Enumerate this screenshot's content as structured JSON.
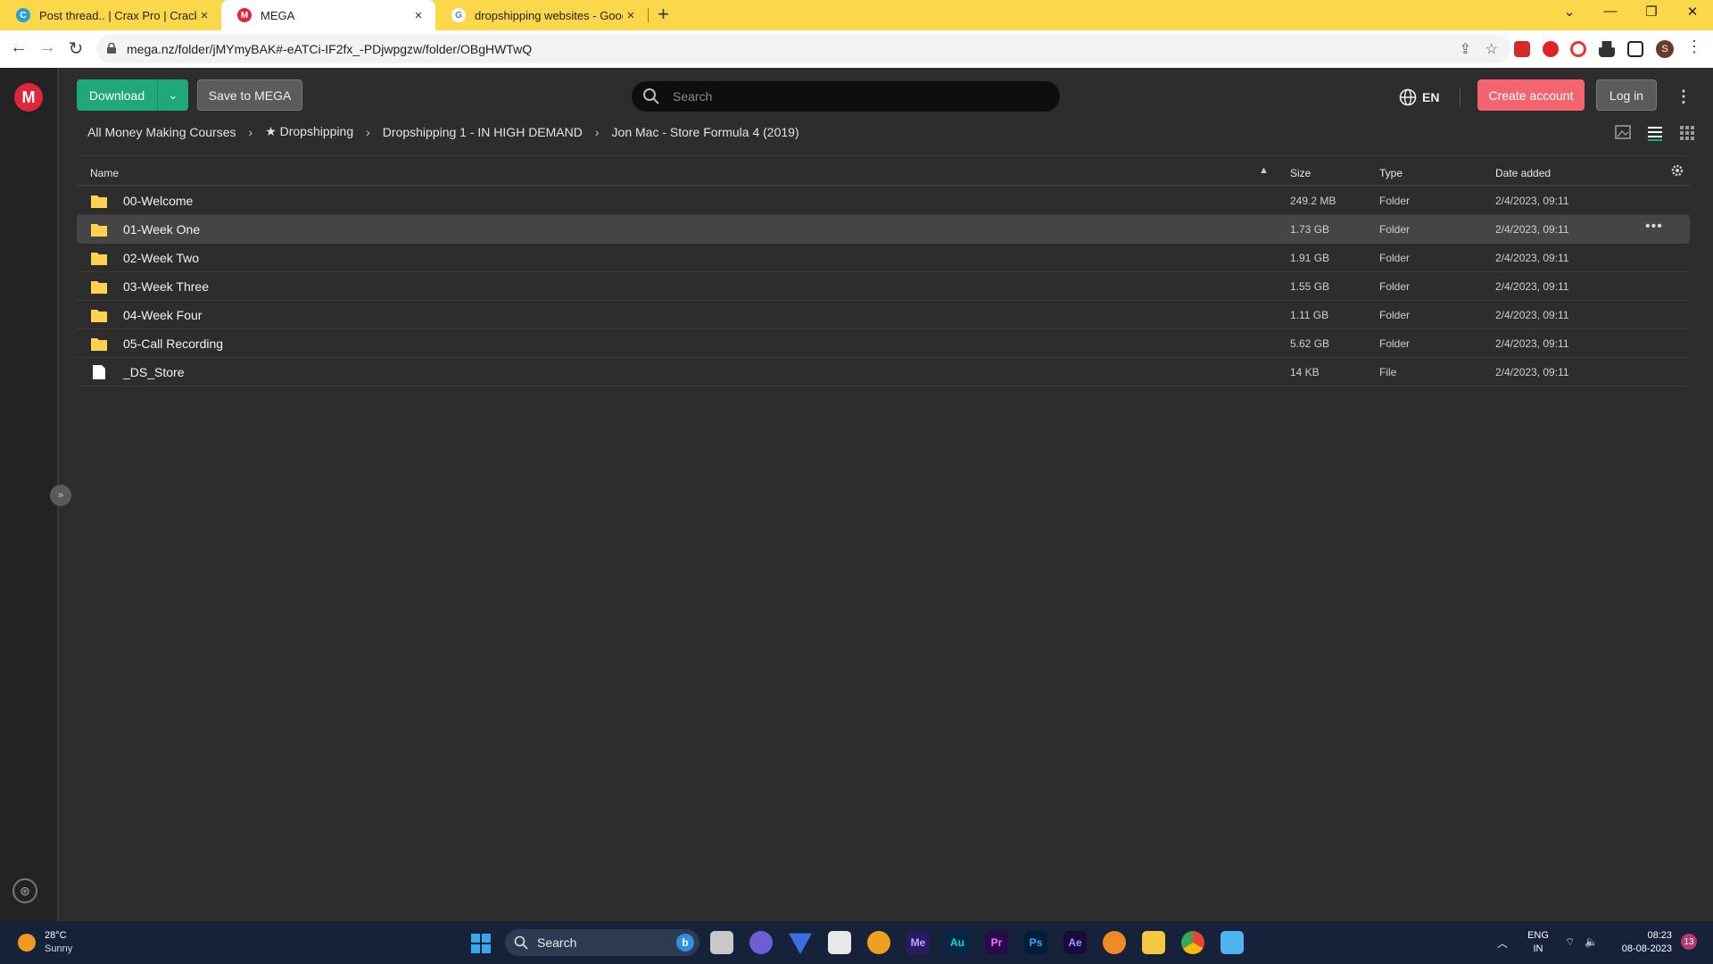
{
  "browser": {
    "tabs": [
      {
        "title": "Post thread.. | Crax Pro | Cracking",
        "favicon": "crax-favicon",
        "close": "×"
      },
      {
        "title": "MEGA",
        "favicon": "mega-favicon",
        "close": "×"
      },
      {
        "title": "dropshipping websites - Google",
        "favicon": "google-favicon",
        "close": "×"
      }
    ],
    "new_tab": "+",
    "url": "mega.nz/folder/jMYmyBAK#-eATCi-IF2fx_-PDjwpgzw/folder/OBgHWTwQ",
    "profile_initial": "S"
  },
  "mega": {
    "logo": "M",
    "download_label": "Download",
    "save_label": "Save to MEGA",
    "search_placeholder": "Search",
    "language": "EN",
    "create_account_label": "Create account",
    "login_label": "Log in",
    "breadcrumbs": [
      "All Money Making Courses",
      "★ Dropshipping",
      "Dropshipping 1 - IN HIGH DEMAND",
      "Jon Mac - Store Formula 4 (2019)"
    ],
    "columns": {
      "name": "Name",
      "size": "Size",
      "type": "Type",
      "date": "Date added"
    },
    "rows": [
      {
        "name": "00-Welcome",
        "size": "249.2 MB",
        "type": "Folder",
        "date": "2/4/2023, 09:11",
        "kind": "folder"
      },
      {
        "name": "01-Week One",
        "size": "1.73 GB",
        "type": "Folder",
        "date": "2/4/2023, 09:11",
        "kind": "folder"
      },
      {
        "name": "02-Week Two",
        "size": "1.91 GB",
        "type": "Folder",
        "date": "2/4/2023, 09:11",
        "kind": "folder"
      },
      {
        "name": "03-Week Three",
        "size": "1.55 GB",
        "type": "Folder",
        "date": "2/4/2023, 09:11",
        "kind": "folder"
      },
      {
        "name": "04-Week Four",
        "size": "1.11 GB",
        "type": "Folder",
        "date": "2/4/2023, 09:11",
        "kind": "folder"
      },
      {
        "name": "05-Call Recording",
        "size": "5.62 GB",
        "type": "Folder",
        "date": "2/4/2023, 09:11",
        "kind": "folder"
      },
      {
        "name": "_DS_Store",
        "size": "14 KB",
        "type": "File",
        "date": "2/4/2023, 09:11",
        "kind": "file"
      }
    ],
    "row_more": "•••"
  },
  "taskbar": {
    "temperature": "28°C",
    "weather": "Sunny",
    "search_label": "Search",
    "apps": [
      "Me",
      "Au",
      "Pr",
      "Ps",
      "Ae"
    ],
    "lang_top": "ENG",
    "lang_bottom": "IN",
    "time": "08:23",
    "date": "08-08-2023",
    "notifications": "13"
  },
  "colors": {
    "accent_green": "#1fa879",
    "create_red": "#f2656f",
    "mega_red": "#e0263a",
    "folder_yellow": "#ffd24d",
    "tabstrip_yellow": "#fbd84a"
  }
}
